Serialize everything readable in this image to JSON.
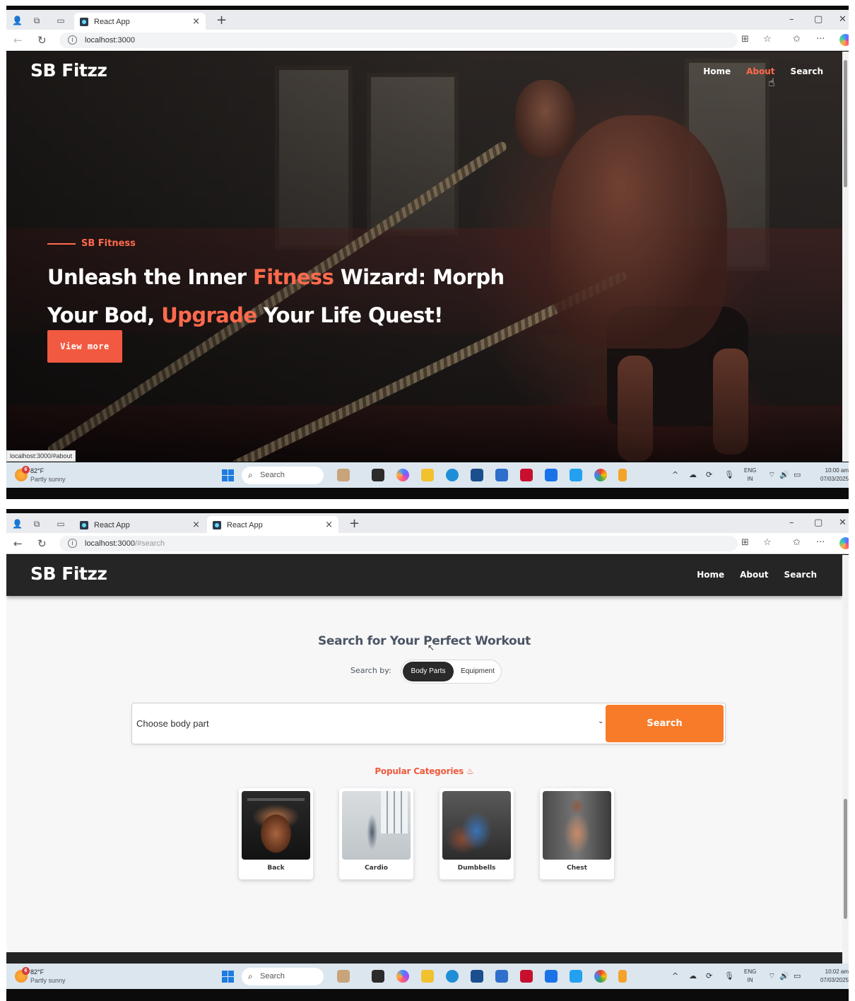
{
  "colors": {
    "accent": "#ff6a4d",
    "search_button": "#f77b28",
    "header_dark": "#252525",
    "taskbar": "#dbe6ef"
  },
  "shot1": {
    "tabs": [
      {
        "title": "React App",
        "active": true
      }
    ],
    "url": "localhost:3000",
    "url_path": "",
    "brand": "SB Fitzz",
    "nav": [
      {
        "label": "Home"
      },
      {
        "label": "About",
        "hovered": true
      },
      {
        "label": "Search"
      }
    ],
    "hero": {
      "eyebrow": "SB Fitness",
      "line1_a": "Unleash the Inner ",
      "line1_accent": "Fitness",
      "line1_b": " Wizard: Morph",
      "line2_a": "Your Bod, ",
      "line2_accent": "Upgrade",
      "line2_b": " Your Life Quest!",
      "button": "View more"
    },
    "status_url": "localhost:3000/#about",
    "taskbar": {
      "weather_temp": "82°F",
      "weather_desc": "Partly sunny",
      "weather_badge": "6",
      "search": "Search",
      "lang1": "ENG",
      "lang2": "IN",
      "time": "10:00 am",
      "date": "07/03/2025"
    }
  },
  "shot2": {
    "tabs": [
      {
        "title": "React App",
        "active": false
      },
      {
        "title": "React App",
        "active": true
      }
    ],
    "url": "localhost:3000",
    "url_path": "/#search",
    "brand": "SB Fitzz",
    "nav": [
      {
        "label": "Home"
      },
      {
        "label": "About"
      },
      {
        "label": "Search"
      }
    ],
    "search": {
      "title": "Search for Your Perfect Workout",
      "search_by_label": "Search by:",
      "toggle_options": [
        "Body Parts",
        "Equipment"
      ],
      "selected_toggle": "Body Parts",
      "select_placeholder": "Choose body part",
      "button": "Search",
      "popular_title": "Popular Categories",
      "popular_icon": "fire-icon"
    },
    "categories": [
      {
        "label": "Back",
        "image": "back-muscles-photo"
      },
      {
        "label": "Cardio",
        "image": "jump-rope-photo"
      },
      {
        "label": "Dumbbells",
        "image": "dumbbell-lifting-photo"
      },
      {
        "label": "Chest",
        "image": "chest-muscles-photo"
      }
    ],
    "taskbar": {
      "weather_temp": "82°F",
      "weather_desc": "Partly sunny",
      "weather_badge": "6",
      "search": "Search",
      "lang1": "ENG",
      "lang2": "IN",
      "time": "10:02 am",
      "date": "07/03/2025"
    }
  }
}
